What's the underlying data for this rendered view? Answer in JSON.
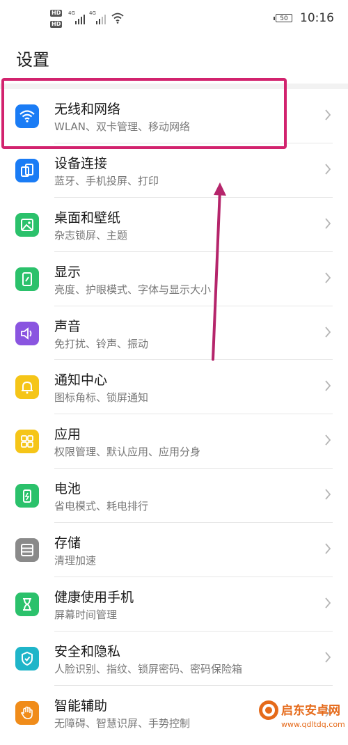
{
  "status_bar": {
    "hd1": "HD",
    "hd2": "HD",
    "net1": "4G",
    "net2": "4G",
    "battery": "50",
    "time": "10:16"
  },
  "page_title": "设置",
  "items": [
    {
      "title": "无线和网络",
      "subtitle": "WLAN、双卡管理、移动网络",
      "icon": "wifi-icon",
      "color": "#1a7cf5"
    },
    {
      "title": "设备连接",
      "subtitle": "蓝牙、手机投屏、打印",
      "icon": "device-link-icon",
      "color": "#1a7cf5"
    },
    {
      "title": "桌面和壁纸",
      "subtitle": "杂志锁屏、主题",
      "icon": "wallpaper-icon",
      "color": "#2bc16b"
    },
    {
      "title": "显示",
      "subtitle": "亮度、护眼模式、字体与显示大小",
      "icon": "display-icon",
      "color": "#2bc16b"
    },
    {
      "title": "声音",
      "subtitle": "免打扰、铃声、振动",
      "icon": "speaker-icon",
      "color": "#8a55e0"
    },
    {
      "title": "通知中心",
      "subtitle": "图标角标、锁屏通知",
      "icon": "bell-icon",
      "color": "#f5c518"
    },
    {
      "title": "应用",
      "subtitle": "权限管理、默认应用、应用分身",
      "icon": "apps-grid-icon",
      "color": "#f5c518"
    },
    {
      "title": "电池",
      "subtitle": "省电模式、耗电排行",
      "icon": "battery-icon",
      "color": "#2bc16b"
    },
    {
      "title": "存储",
      "subtitle": "清理加速",
      "icon": "storage-icon",
      "color": "#8a8a8a"
    },
    {
      "title": "健康使用手机",
      "subtitle": "屏幕时间管理",
      "icon": "hourglass-icon",
      "color": "#2bc16b"
    },
    {
      "title": "安全和隐私",
      "subtitle": "人脸识别、指纹、锁屏密码、密码保险箱",
      "icon": "shield-icon",
      "color": "#1fb5c9"
    },
    {
      "title": "智能辅助",
      "subtitle": "无障碍、智慧识屏、手势控制",
      "icon": "hand-icon",
      "color": "#f08c1a"
    }
  ],
  "watermark": {
    "name": "启东安卓网",
    "url": "www.qdltdq.com"
  }
}
